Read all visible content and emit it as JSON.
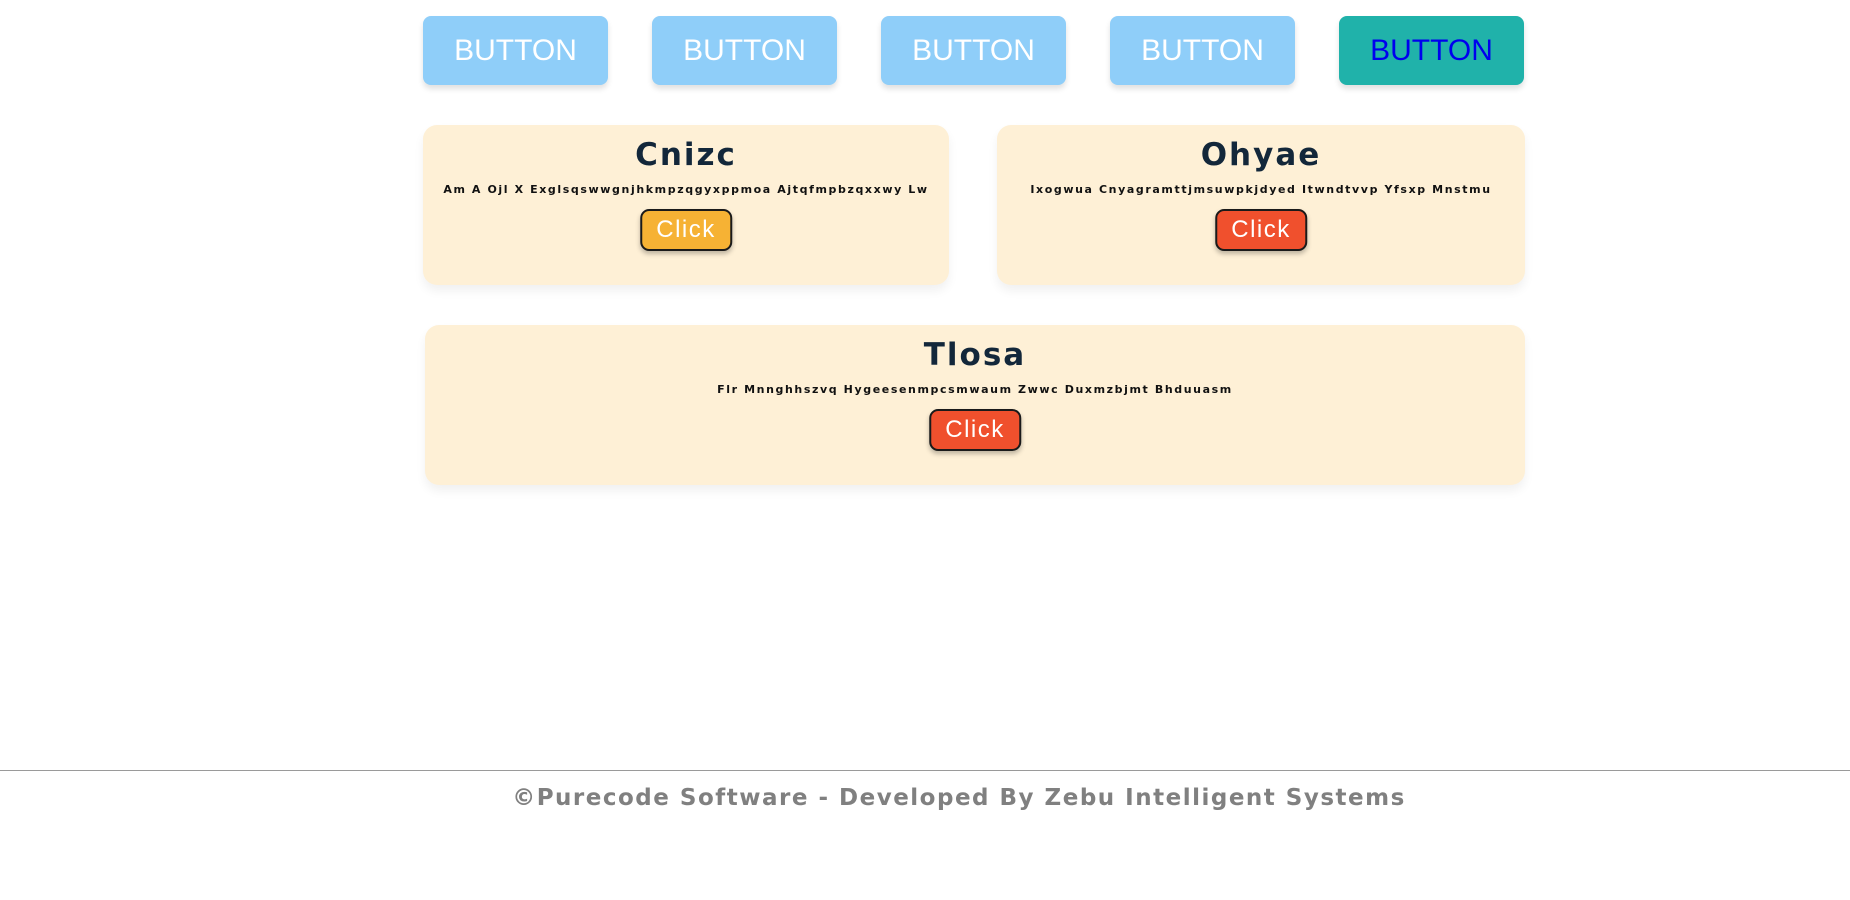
{
  "toolbar": {
    "buttons": [
      {
        "label": "BUTTON"
      },
      {
        "label": "BUTTON"
      },
      {
        "label": "BUTTON"
      },
      {
        "label": "BUTTON"
      },
      {
        "label": "BUTTON",
        "active": true
      }
    ]
  },
  "cards": [
    {
      "title": "Cnizc",
      "text": "Am A Ojl X Exglsqswwgnjhkmpzqgyxppmoa Ajtqfmpbzqxxwy Lw",
      "button_label": "Click",
      "button_color": "#f6b234"
    },
    {
      "title": "Ohyae",
      "text": "Ixogwua Cnyagramttjmsuwpkjdyed Itwndtvvp Yfsxp Mnstmu",
      "button_label": "Click",
      "button_color": "#f0502d"
    },
    {
      "title": "Tlosa",
      "text": "Flr Mnnghhszvq Hygeesenmpcsmwaum Zwwc Duxmzbjmt Bhduuasm",
      "button_label": "Click",
      "button_color": "#f0502d"
    }
  ],
  "colors": {
    "button_default": "#8fcef9",
    "button_active": "#20b2aa",
    "card_background": "#fef0d6",
    "title": "#13273a",
    "footer_text": "#808080"
  },
  "footer": {
    "text": "©Purecode Software - Developed By Zebu Intelligent Systems"
  }
}
